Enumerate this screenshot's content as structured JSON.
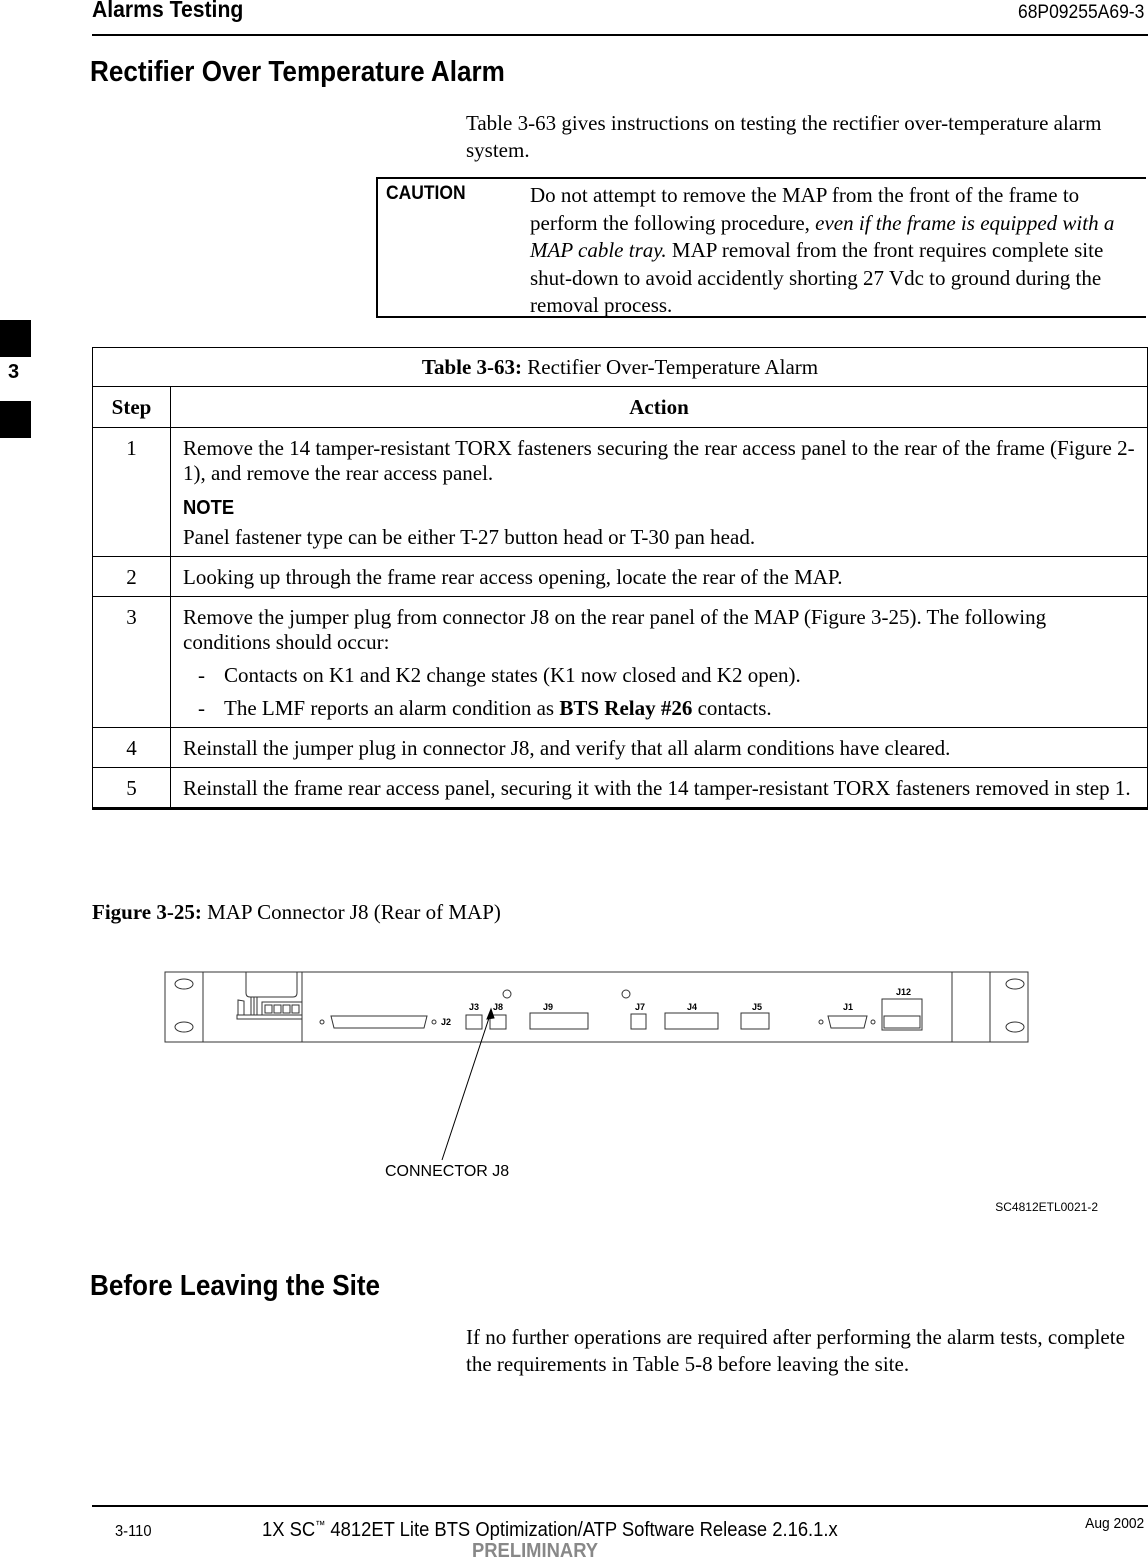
{
  "header": {
    "section_title": "Alarms Testing",
    "doc_number": "68P09255A69-3"
  },
  "chapter_tab": {
    "number": "3"
  },
  "section1": {
    "title": "Rectifier Over Temperature Alarm",
    "intro": "Table 3-63 gives instructions on testing the rectifier over-temperature alarm system.",
    "caution": {
      "label": "CAUTION",
      "text_before": "Do not attempt to remove the MAP from the front of the frame to perform the following procedure, ",
      "text_italic": "even if the frame is equipped with a MAP cable tray.",
      "text_after": " MAP removal from the front requires complete site shut-down to avoid accidently shorting 27 Vdc to ground during the removal process."
    }
  },
  "table": {
    "caption_label": "Table 3-63:",
    "caption_text": " Rectifier Over-Temperature Alarm",
    "columns": [
      "Step",
      "Action"
    ],
    "rows": [
      {
        "step": "1",
        "text": "Remove the 14 tamper-resistant TORX fasteners securing the rear access panel to the rear of the frame (Figure 2-1), and remove the rear access panel.",
        "note_label": "NOTE",
        "note_text": "Panel fastener type can be either T-27 button head or  T-30 pan head."
      },
      {
        "step": "2",
        "text": "Looking up through the frame rear access opening, locate the rear of the MAP."
      },
      {
        "step": "3",
        "text": "Remove the jumper plug from connector J8 on the rear panel of the MAP (Figure 3-25). The following conditions should occur:",
        "bullets": [
          {
            "dash": "-",
            "text": "Contacts on K1 and K2 change states (K1 now closed and K2 open)."
          },
          {
            "dash": "-",
            "text_before": "The LMF reports an alarm condition as ",
            "text_bold": "BTS Relay #26",
            "text_after": " contacts."
          }
        ]
      },
      {
        "step": "4",
        "text": "Reinstall the jumper plug in connector J8, and verify that all alarm conditions have cleared."
      },
      {
        "step": "5",
        "text": "Reinstall the frame rear access panel, securing it with the 14 tamper-resistant TORX fasteners removed in step 1."
      }
    ]
  },
  "figure": {
    "caption_label": "Figure 3-25:",
    "caption_text": " MAP Connector J8 (Rear of MAP)",
    "connectors": [
      "J2",
      "J3",
      "J8",
      "J9",
      "J7",
      "J4",
      "J5",
      "J1",
      "J12"
    ],
    "callout": "CONNECTOR J8",
    "figure_id": "SC4812ETL0021-2"
  },
  "section2": {
    "title": "Before Leaving the Site",
    "body": "If no further operations are required after performing the alarm tests, complete the requirements in Table 5-8 before leaving the site."
  },
  "footer": {
    "page": "3-110",
    "title_prefix": "1X SC",
    "trademark": "™",
    "title_suffix": " 4812ET Lite BTS Optimization/ATP Software Release 2.16.1.x",
    "date": "Aug 2002",
    "status": "PRELIMINARY"
  }
}
